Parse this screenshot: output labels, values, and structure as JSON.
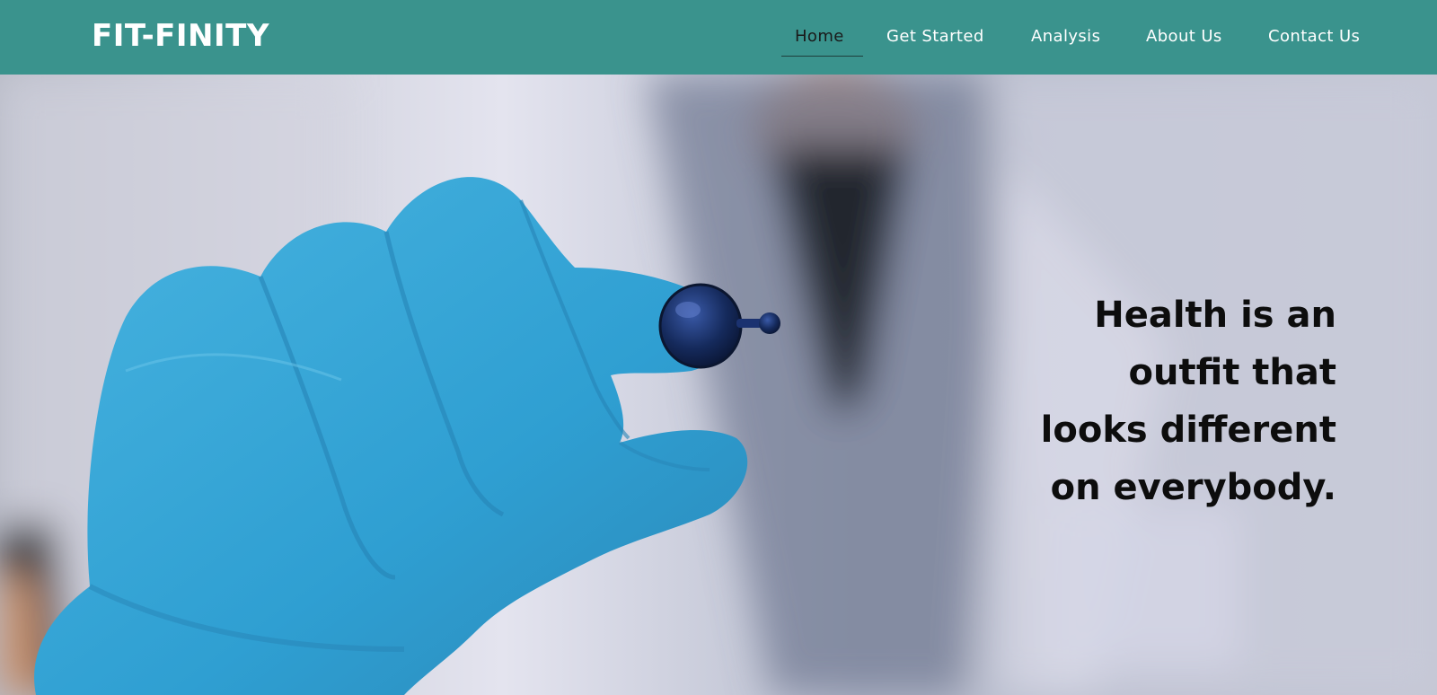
{
  "brand": {
    "name": "FIT-FINITY"
  },
  "nav": {
    "items": [
      {
        "label": "Home",
        "active": true
      },
      {
        "label": "Get Started",
        "active": false
      },
      {
        "label": "Analysis",
        "active": false
      },
      {
        "label": "About Us",
        "active": false
      },
      {
        "label": "Contact Us",
        "active": false
      }
    ]
  },
  "hero": {
    "tagline": "Health is an outfit that looks different on everybody.",
    "image": "gloved hand holding a dark blue capsule"
  },
  "colors": {
    "navbar": "#3a938d",
    "glove": "#3aa6d6",
    "capsule": "#152a5c",
    "tagline_text": "#0d0d0d"
  }
}
